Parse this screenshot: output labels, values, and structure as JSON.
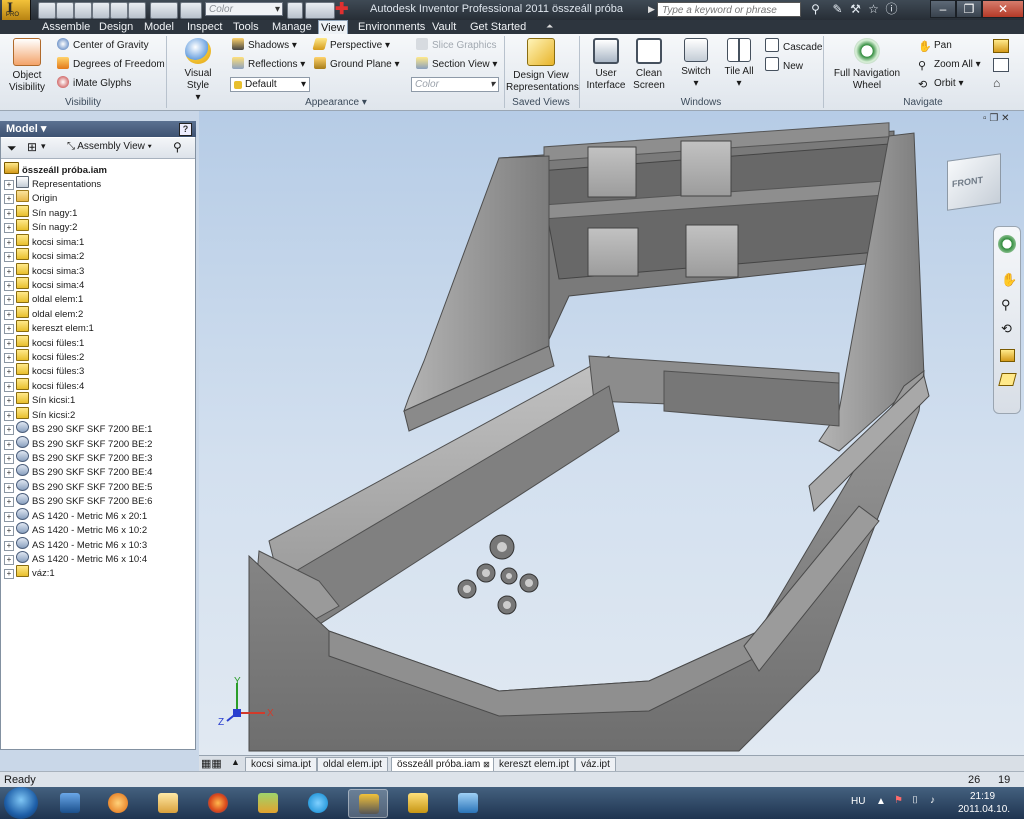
{
  "titlebar": {
    "app_badge": "I",
    "app_badge_sub": "PRO",
    "color_placeholder": "Color",
    "title": "Autodesk Inventor Professional 2011    összeáll próba",
    "search_placeholder": "Type a keyword or phrase"
  },
  "tabs": [
    "Assemble",
    "Design",
    "Model",
    "Inspect",
    "Tools",
    "Manage",
    "View",
    "Environments",
    "Vault",
    "Get Started"
  ],
  "active_tab": "View",
  "ribbon": {
    "visibility": {
      "object_visibility_1": "Object",
      "object_visibility_2": "Visibility",
      "center_of_gravity": "Center of Gravity",
      "degrees_of_freedom": "Degrees of Freedom",
      "imate_glyphs": "iMate Glyphs",
      "label": "Visibility"
    },
    "appearance": {
      "visual_style": "Visual Style",
      "shadows": "Shadows",
      "reflections": "Reflections",
      "default_combo": "Default",
      "perspective": "Perspective",
      "ground_plane": "Ground Plane",
      "slice_graphics": "Slice Graphics",
      "section_view": "Section View",
      "color_combo": "Color",
      "label": "Appearance"
    },
    "saved_views": {
      "design_view_1": "Design View",
      "design_view_2": "Representations",
      "label": "Saved Views"
    },
    "windows": {
      "user_interface_1": "User",
      "user_interface_2": "Interface",
      "clean_screen_1": "Clean",
      "clean_screen_2": "Screen",
      "switch": "Switch",
      "tile_all": "Tile All",
      "cascade": "Cascade",
      "new": "New",
      "label": "Windows"
    },
    "navigate": {
      "full_nav_1": "Full Navigation",
      "full_nav_2": "Wheel",
      "pan": "Pan",
      "zoom_all": "Zoom All",
      "orbit": "Orbit",
      "label": "Navigate"
    }
  },
  "browser": {
    "header": "Model",
    "assembly_view": "Assembly View",
    "root": "összeáll próba.iam",
    "items": [
      {
        "label": "Representations",
        "type": "rep"
      },
      {
        "label": "Origin",
        "type": "folder"
      },
      {
        "label": "Sín nagy:1",
        "type": "part"
      },
      {
        "label": "Sín nagy:2",
        "type": "part"
      },
      {
        "label": "kocsi sima:1",
        "type": "part"
      },
      {
        "label": "kocsi sima:2",
        "type": "part"
      },
      {
        "label": "kocsi sima:3",
        "type": "part"
      },
      {
        "label": "kocsi sima:4",
        "type": "part"
      },
      {
        "label": "oldal elem:1",
        "type": "part"
      },
      {
        "label": "oldal elem:2",
        "type": "part"
      },
      {
        "label": "kereszt elem:1",
        "type": "part"
      },
      {
        "label": "kocsi füles:1",
        "type": "part"
      },
      {
        "label": "kocsi füles:2",
        "type": "part"
      },
      {
        "label": "kocsi füles:3",
        "type": "part"
      },
      {
        "label": "kocsi füles:4",
        "type": "part"
      },
      {
        "label": "Sín kicsi:1",
        "type": "part"
      },
      {
        "label": "Sín kicsi:2",
        "type": "part"
      },
      {
        "label": "BS 290 SKF SKF 7200 BE:1",
        "type": "bearing"
      },
      {
        "label": "BS 290 SKF SKF 7200 BE:2",
        "type": "bearing"
      },
      {
        "label": "BS 290 SKF SKF 7200 BE:3",
        "type": "bearing"
      },
      {
        "label": "BS 290 SKF SKF 7200 BE:4",
        "type": "bearing"
      },
      {
        "label": "BS 290 SKF SKF 7200 BE:5",
        "type": "bearing"
      },
      {
        "label": "BS 290 SKF SKF 7200 BE:6",
        "type": "bearing"
      },
      {
        "label": "AS 1420 - Metric M6 x 20:1",
        "type": "bearing"
      },
      {
        "label": "AS 1420 - Metric M6 x 10:2",
        "type": "bearing"
      },
      {
        "label": "AS 1420 - Metric M6 x 10:3",
        "type": "bearing"
      },
      {
        "label": "AS 1420 - Metric M6 x 10:4",
        "type": "bearing"
      },
      {
        "label": "váz:1",
        "type": "part"
      }
    ]
  },
  "viewcube_label": "FRONT",
  "axis_labels": {
    "x": "X",
    "y": "Y",
    "z": "Z"
  },
  "doc_tabs": [
    "kocsi sima.ipt",
    "oldal elem.ipt",
    "összeáll próba.iam",
    "kereszt elem.ipt",
    "váz.ipt"
  ],
  "active_doc_tab": "összeáll próba.iam",
  "status": {
    "text": "Ready",
    "count1": "26",
    "count2": "19"
  },
  "taskbar": {
    "lang": "HU",
    "time": "21:19",
    "date": "2011.04.10."
  },
  "colors": {
    "accent": "#3e5272",
    "model_gray": "#8a8a8a",
    "viewport_top": "#b6cce6"
  }
}
